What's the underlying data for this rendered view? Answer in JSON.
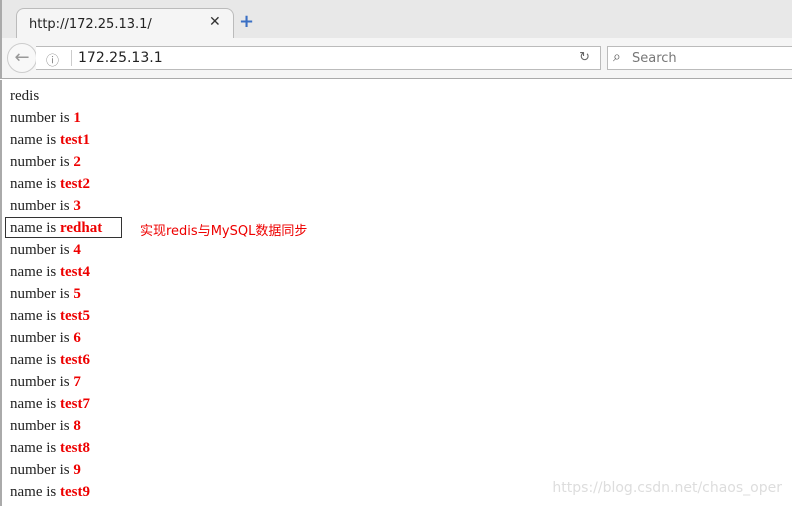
{
  "browser": {
    "tab_title": "http://172.25.13.1/",
    "url": "172.25.13.1",
    "search_placeholder": "Search"
  },
  "page": {
    "heading": "redis",
    "rows": [
      {
        "label": "number is ",
        "value": "1"
      },
      {
        "label": "name is ",
        "value": "test1"
      },
      {
        "label": "number is ",
        "value": "2"
      },
      {
        "label": "name is ",
        "value": "test2"
      },
      {
        "label": "number is ",
        "value": "3"
      },
      {
        "label": "name is ",
        "value": "redhat"
      },
      {
        "label": "number is ",
        "value": "4"
      },
      {
        "label": "name is ",
        "value": "test4"
      },
      {
        "label": "number is ",
        "value": "5"
      },
      {
        "label": "name is ",
        "value": "test5"
      },
      {
        "label": "number is ",
        "value": "6"
      },
      {
        "label": "name is ",
        "value": "test6"
      },
      {
        "label": "number is ",
        "value": "7"
      },
      {
        "label": "name is ",
        "value": "test7"
      },
      {
        "label": "number is ",
        "value": "8"
      },
      {
        "label": "name is ",
        "value": "test8"
      },
      {
        "label": "number is ",
        "value": "9"
      },
      {
        "label": "name is ",
        "value": "test9"
      }
    ],
    "annotation": "实现redis与MySQL数据同步",
    "watermark": "https://blog.csdn.net/chaos_oper"
  },
  "colors": {
    "value": "#ee0000",
    "annotation": "#ee0000"
  }
}
